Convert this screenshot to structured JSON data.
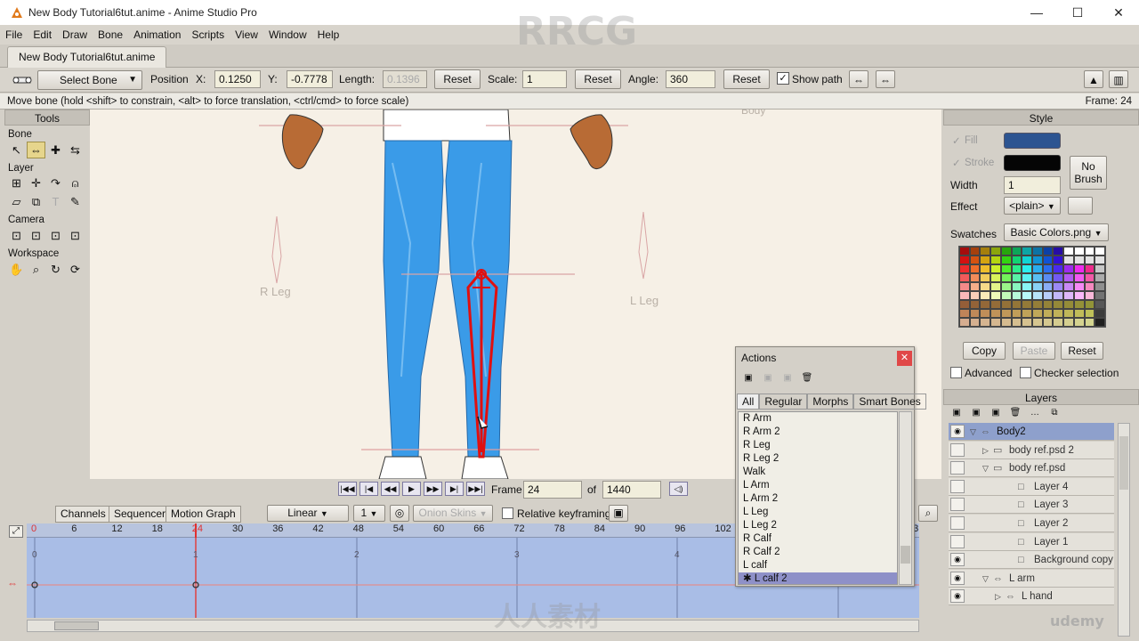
{
  "window": {
    "title": "New Body Tutorial6tut.anime - Anime Studio Pro",
    "minimize": "—",
    "maximize": "☐",
    "close": "✕"
  },
  "menu": [
    "File",
    "Edit",
    "Draw",
    "Bone",
    "Animation",
    "Scripts",
    "View",
    "Window",
    "Help"
  ],
  "doc_tab": "New Body Tutorial6tut.anime",
  "tool_options": {
    "tool_select": "Select Bone",
    "position_label": "Position",
    "x_label": "X:",
    "x_value": "0.1250",
    "y_label": "Y:",
    "y_value": "-0.7778",
    "length_label": "Length:",
    "length_value": "0.1396",
    "reset1": "Reset",
    "scale_label": "Scale:",
    "scale_value": "1",
    "reset2": "Reset",
    "angle_label": "Angle:",
    "angle_value": "360",
    "reset3": "Reset",
    "show_path": "Show path"
  },
  "hint": {
    "text": "Move bone (hold <shift> to constrain, <alt> to force translation, <ctrl/cmd> to force scale)",
    "frame": "Frame: 24"
  },
  "tools": {
    "title": "Tools",
    "bone": "Bone",
    "layer": "Layer",
    "camera": "Camera",
    "workspace": "Workspace"
  },
  "canvas": {
    "label_body": "Body",
    "label_rleg": "R Leg",
    "label_lleg": "L Leg"
  },
  "navigation": {
    "frame_label": "Frame",
    "frame_value": "24",
    "of_label": "of",
    "total_frames": "1440"
  },
  "timeline": {
    "tabs": [
      "Channels",
      "Sequencer",
      "Motion Graph"
    ],
    "interp": "Linear",
    "step": "1",
    "onion": "Onion Skins",
    "relative_kf": "Relative keyframing",
    "ruler": [
      "0",
      "6",
      "12",
      "18",
      "24",
      "30",
      "36",
      "42",
      "48",
      "54",
      "60",
      "66",
      "72",
      "78",
      "84",
      "90",
      "96",
      "102"
    ],
    "ruler_end": "13",
    "markers": [
      "0",
      "1",
      "2",
      "3",
      "4"
    ]
  },
  "style": {
    "title": "Style",
    "fill": "Fill",
    "stroke": "Stroke",
    "fill_color": "#2c5491",
    "stroke_color": "#050505",
    "no_brush": "No Brush",
    "width_label": "Width",
    "width_value": "1",
    "effect_label": "Effect",
    "effect_value": "<plain>",
    "swatches_label": "Swatches",
    "swatches_value": "Basic Colors.png",
    "copy": "Copy",
    "paste": "Paste",
    "reset": "Reset",
    "advanced": "Advanced",
    "checker": "Checker selection"
  },
  "layers": {
    "title": "Layers",
    "rows": [
      {
        "name": "Body2",
        "indent": 0,
        "sel": true,
        "eye": true,
        "icon": "bone"
      },
      {
        "name": "body ref.psd 2",
        "indent": 1,
        "sel": false,
        "eye": false,
        "icon": "group"
      },
      {
        "name": "body ref.psd",
        "indent": 1,
        "sel": false,
        "eye": false,
        "icon": "group"
      },
      {
        "name": "Layer 4",
        "indent": 3,
        "sel": false,
        "eye": false,
        "icon": "img"
      },
      {
        "name": "Layer 3",
        "indent": 3,
        "sel": false,
        "eye": false,
        "icon": "img"
      },
      {
        "name": "Layer 2",
        "indent": 3,
        "sel": false,
        "eye": false,
        "icon": "img"
      },
      {
        "name": "Layer 1",
        "indent": 3,
        "sel": false,
        "eye": false,
        "icon": "img"
      },
      {
        "name": "Background copy",
        "indent": 3,
        "sel": false,
        "eye": true,
        "icon": "img"
      },
      {
        "name": "L arm",
        "indent": 1,
        "sel": false,
        "eye": true,
        "icon": "bone"
      },
      {
        "name": "L hand",
        "indent": 2,
        "sel": false,
        "eye": true,
        "icon": "bone"
      }
    ]
  },
  "actions": {
    "title": "Actions",
    "tabs": [
      "All",
      "Regular",
      "Morphs",
      "Smart Bones"
    ],
    "items": [
      "R Arm",
      "R Arm 2",
      "R Leg",
      "R Leg 2",
      "Walk",
      "L Arm",
      "L Arm 2",
      "L Leg",
      "L Leg 2",
      "R Calf",
      "R Calf 2",
      "L calf",
      "L calf 2"
    ],
    "selected": "L calf 2"
  },
  "watermarks": {
    "brand": "RRCG",
    "cn": "人人素材",
    "udemy": "udemy"
  }
}
